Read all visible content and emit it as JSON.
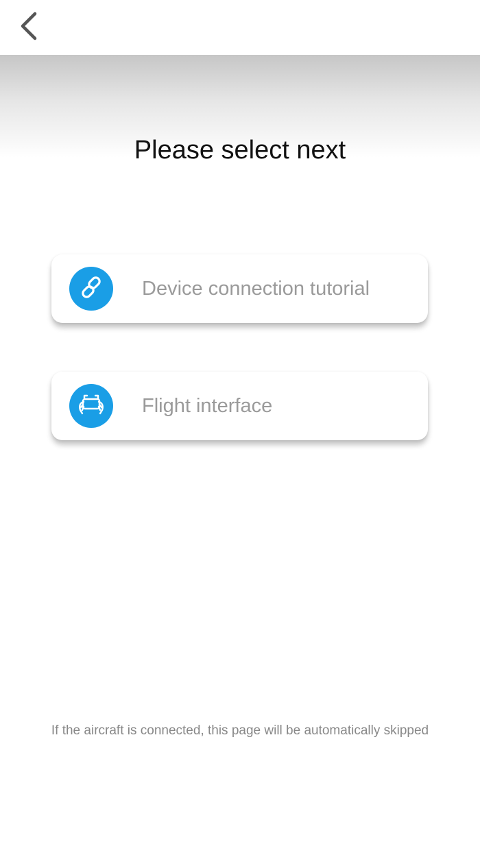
{
  "nav": {
    "back_icon": "chevron-left-icon"
  },
  "page": {
    "title": "Please select next"
  },
  "options": [
    {
      "label": "Device connection tutorial",
      "icon": "link-icon"
    },
    {
      "label": "Flight interface",
      "icon": "remote-controller-icon"
    }
  ],
  "footer": {
    "note": "If the aircraft is connected, this page will be automatically skipped"
  },
  "colors": {
    "accent": "#1a9ee6",
    "label_text": "#9a9a9a",
    "title_text": "#111111",
    "footer_text": "#888888",
    "back_icon": "#555555"
  }
}
